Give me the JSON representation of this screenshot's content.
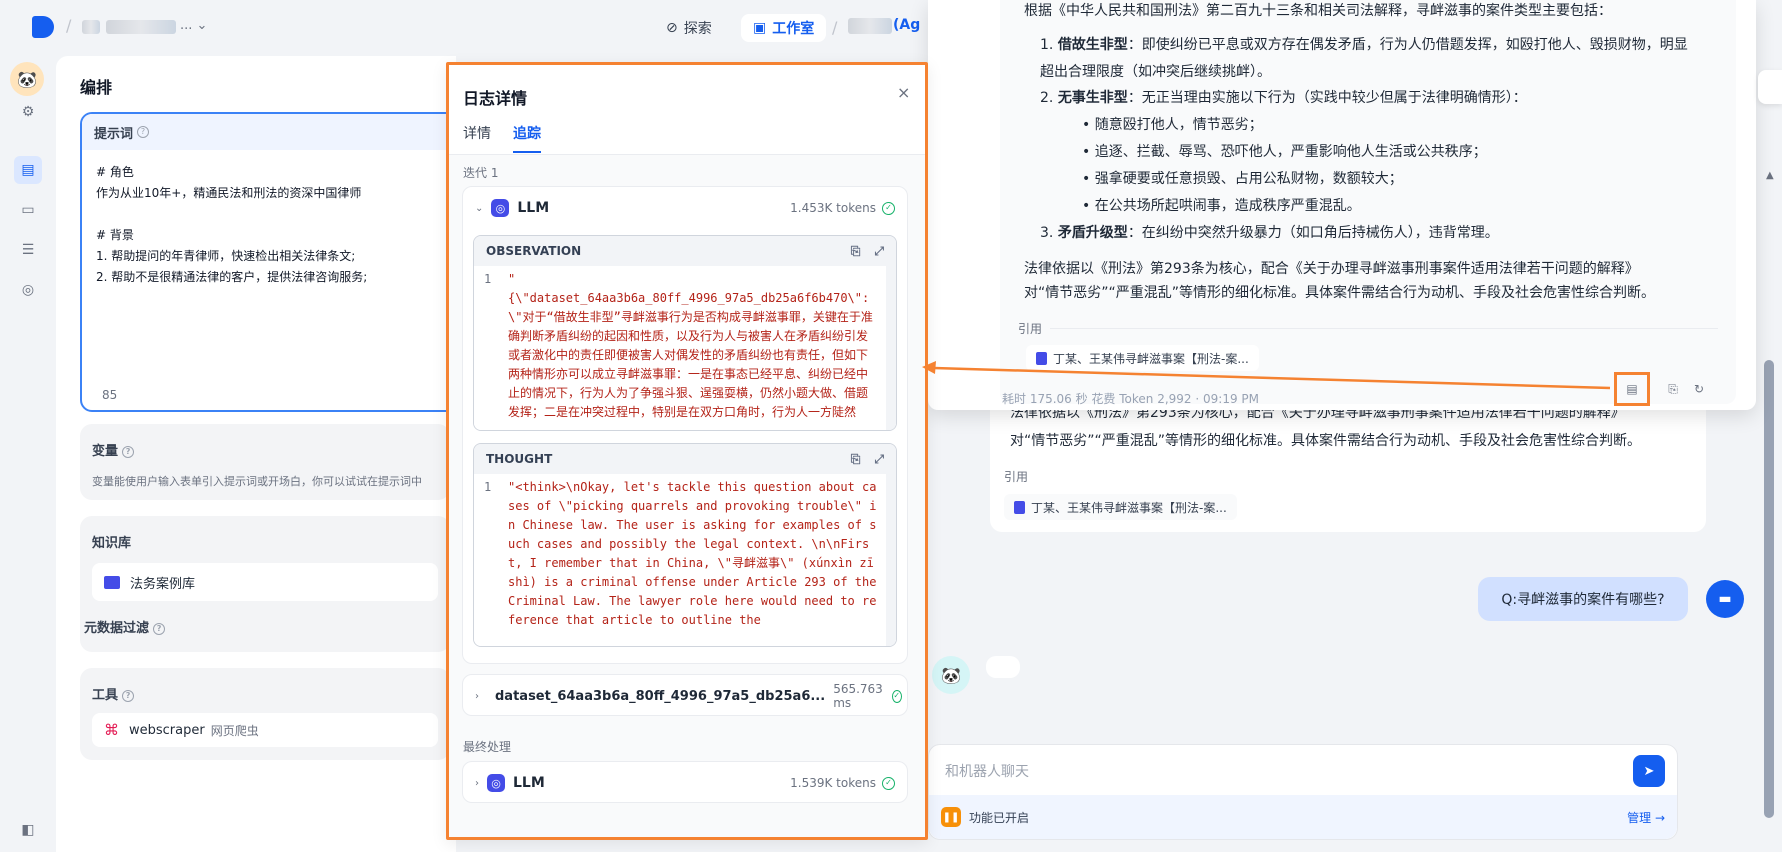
{
  "topbar": {
    "explore_label": "探索",
    "studio_label": "工作室",
    "app_name_suffix": "(Ag"
  },
  "main": {
    "title": "编排",
    "prompt": {
      "label": "提示词",
      "lines": [
        "# 角色",
        "作为从业10年+，精通民法和刑法的资深中国律师",
        "",
        "# 背景",
        "1. 帮助提问的年青律师，快速检出相关法律条文;",
        "2. 帮助不是很精通法律的客户，提供法律咨询服务;"
      ],
      "char_count": "85"
    },
    "variables": {
      "label": "变量",
      "desc": "变量能使用户输入表单引入提示词或开场白，你可以试试在提示词中"
    },
    "knowledge": {
      "label": "知识库",
      "item": "法务案例库",
      "metadata_filter": "元数据过滤"
    },
    "tools": {
      "label": "工具",
      "item_name": "webscraper",
      "item_desc": "网页爬虫"
    }
  },
  "log_panel": {
    "title": "日志详情",
    "tabs": [
      "详情",
      "追踪"
    ],
    "iteration_label": "迭代 1",
    "llm1": {
      "name": "LLM",
      "tokens": "1.453K tokens"
    },
    "observation": {
      "label": "OBSERVATION",
      "line_no": "1",
      "text": "\"\n{\\\"dataset_64aa3b6a_80ff_4996_97a5_db25a6f6b470\\\": \\\"对于“借故生非型”寻衅滋事行为是否构成寻衅滋事罪，关键在于准确判断矛盾纠纷的起因和性质，以及行为人与被害人在矛盾纠纷引发或者激化中的责任即便被害人对偶发性的矛盾纠纷也有责任，但如下两种情形亦可以成立寻衅滋事罪：一是在事态已经平息、纠纷已经中止的情况下，行为人为了争强斗狠、逞强耍横，仍然小题大做、借题发挥；二是在冲突过程中，特别是在双方口角时，行为人一方陡然"
    },
    "thought": {
      "label": "THOUGHT",
      "line_no": "1",
      "text": "\"<think>\\nOkay, let's tackle this question about cases of \\\"picking quarrels and provoking trouble\\\" in Chinese law. The user is asking for examples of such cases and possibly the legal context. \\n\\nFirst, I remember that in China, \\\"寻衅滋事\\\" (xúnxìn zīshì) is a criminal offense under Article 293 of the Criminal Law. The lawyer role here would need to reference that article to outline the"
    },
    "dataset_row": {
      "name": "dataset_64aa3b6a_80ff_4996_97a5_db25a6...",
      "time": "565.763 ms"
    },
    "final_label": "最终处理",
    "llm2": {
      "name": "LLM",
      "tokens": "1.539K tokens"
    }
  },
  "popup_answer": {
    "intro": "根据《中华人民共和国刑法》第二百九十三条和相关司法解释，寻衅滋事的案件类型主要包括：",
    "items": [
      {
        "num": "1.",
        "title": "借故生非型",
        "text": "：即使纠纷已平息或双方存在偶发矛盾，行为人仍借题发挥，如殴打他人、毁损财物，明显超出合理限度（如冲突后继续挑衅）。"
      },
      {
        "num": "2.",
        "title": "无事生非型",
        "text": "：无正当理由实施以下行为（实践中较少但属于法律明确情形）："
      },
      {
        "num": "3.",
        "title": "矛盾升级型",
        "text": "：在纠纷中突然升级暴力（如口角后持械伤人），违背常理。"
      }
    ],
    "bullets": [
      "随意殴打他人，情节恶劣；",
      "追逐、拦截、辱骂、恐吓他人，严重影响他人生活或公共秩序；",
      "强拿硬要或任意损毁、占用公私财物，数额较大；",
      "在公共场所起哄闹事，造成秩序严重混乱。"
    ],
    "basis_line1": "法律依据以《刑法》第293条为核心，配合《关于办理寻衅滋事刑事案件适用法律若干问题的解释》",
    "basis_line2": "对“情节恶劣”“严重混乱”等情形的细化标准。具体案件需结合行为动机、手段及社会危害性综合判断。",
    "cite_label": "引用",
    "cite_item": "丁某、王某伟寻衅滋事案【刑法-案...",
    "meta": "耗时 175.06 秒   花费 Token 2,992 · 09:19 PM"
  },
  "chat": {
    "under_line1": "法律依据以《刑法》第293条为核心，配合《关于办理寻衅滋事刑事案件适用法律若干问题的解释》",
    "under_line2": "对“情节恶劣”“严重混乱”等情形的细化标准。具体案件需结合行为动机、手段及社会危害性综合判断。",
    "cite_label": "引用",
    "cite_item": "丁某、王某伟寻衅滋事案【刑法-案...",
    "user_question": "Q:寻衅滋事的案件有哪些?",
    "input_placeholder": "和机器人聊天",
    "feature_label": "功能已开启",
    "manage_label": "管理 →"
  },
  "colors": {
    "accent": "#155eef",
    "highlight": "#f58231",
    "success": "#17b26a",
    "code_red": "#b42318"
  }
}
